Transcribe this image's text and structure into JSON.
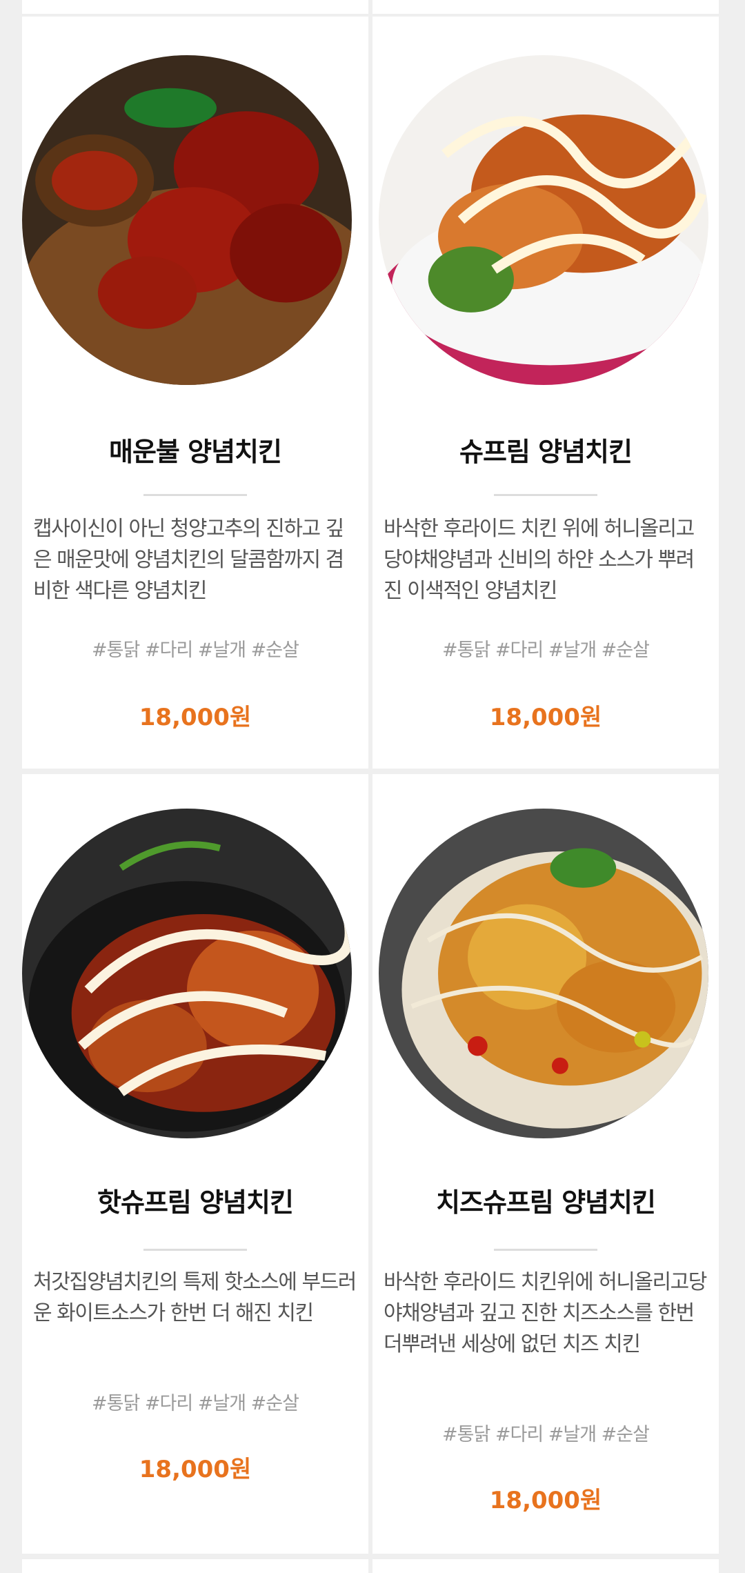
{
  "products": [
    {
      "name": "매운불 양념치킨",
      "description": "캡사이신이 아닌 청양고추의 진하고 깊은 매운맛에 양념치킨의 달콤함까지 겸비한 색다른 양념치킨",
      "tags": "#통닭 #다리 #날개 #순살",
      "price": "18,000원"
    },
    {
      "name": "슈프림 양념치킨",
      "description": "바삭한 후라이드 치킨 위에 허니올리고당야채양념과 신비의 하얀 소스가 뿌려진 이색적인 양념치킨",
      "tags": "#통닭 #다리 #날개 #순살",
      "price": "18,000원"
    },
    {
      "name": "핫슈프림 양념치킨",
      "description": "처갓집양념치킨의 특제 핫소스에 부드러운 화이트소스가 한번 더 해진 치킨",
      "tags": "#통닭 #다리 #날개 #순살",
      "price": "18,000원"
    },
    {
      "name": "치즈슈프림 양념치킨",
      "description": "바삭한 후라이드 치킨위에 허니올리고당야채양념과 깊고 진한 치즈소스를 한번 더뿌려낸 세상에 없던 치즈 치킨",
      "tags": "#통닭 #다리 #날개 #순살",
      "price": "18,000원"
    }
  ],
  "colors": {
    "price": "#e8731e",
    "background": "#efefef",
    "card": "#ffffff"
  }
}
